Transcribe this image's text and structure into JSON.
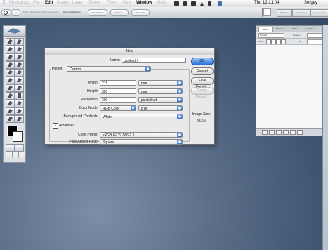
{
  "menubar": {
    "app": "Photoshop",
    "items": [
      "File",
      "Edit",
      "Image",
      "Layer",
      "Select",
      "Filter",
      "View",
      "Window",
      "Help"
    ],
    "clock": "Thu 12:21:04",
    "user": "Sergey"
  },
  "optionsbar": {
    "buttons": [
      "Resize Windows To Fit",
      "Ignore Palettes",
      "Zoom All Windows",
      "Actual Pixels",
      "Fit Screen",
      "Print Size"
    ]
  },
  "palette_well": {
    "tabs": [
      "Brushes",
      "Tool Presets",
      "Layer Comps"
    ]
  },
  "layers_palette": {
    "tabs": [
      "Layers",
      "Channels",
      "Paths",
      "Swatches"
    ],
    "blend_mode": "Normal",
    "opacity_label": "Opacity:",
    "lock_label": "Lock:",
    "fill_label": "Fill:"
  },
  "dialog": {
    "title": "New",
    "name_label": "Name:",
    "name_value": "Untitled-1",
    "preset_label": "Preset:",
    "preset_value": "Custom",
    "width_label": "Width:",
    "width_value": "215",
    "width_unit": "mm",
    "height_label": "Height:",
    "height_value": "305",
    "height_unit": "mm",
    "resolution_label": "Resolution:",
    "resolution_value": "300",
    "resolution_unit": "pixels/inch",
    "color_mode_label": "Color Mode:",
    "color_mode_value": "RGB Color",
    "bit_depth_value": "8 bit",
    "background_label": "Background Contents:",
    "background_value": "White",
    "advanced_label": "Advanced",
    "color_profile_label": "Color Profile:",
    "color_profile_value": "sRGB IEC61966-2.1",
    "pixel_aspect_label": "Pixel Aspect Ratio:",
    "pixel_aspect_value": "Square",
    "ok_label": "OK",
    "cancel_label": "Cancel",
    "save_preset_label": "Save Preset...",
    "delete_preset_label": "Delete Preset...",
    "image_size_label": "Image Size:",
    "image_size_value": "28.6M"
  },
  "colors": {
    "desktop": "#4a5f7b",
    "accent": "#2a6fd9"
  }
}
